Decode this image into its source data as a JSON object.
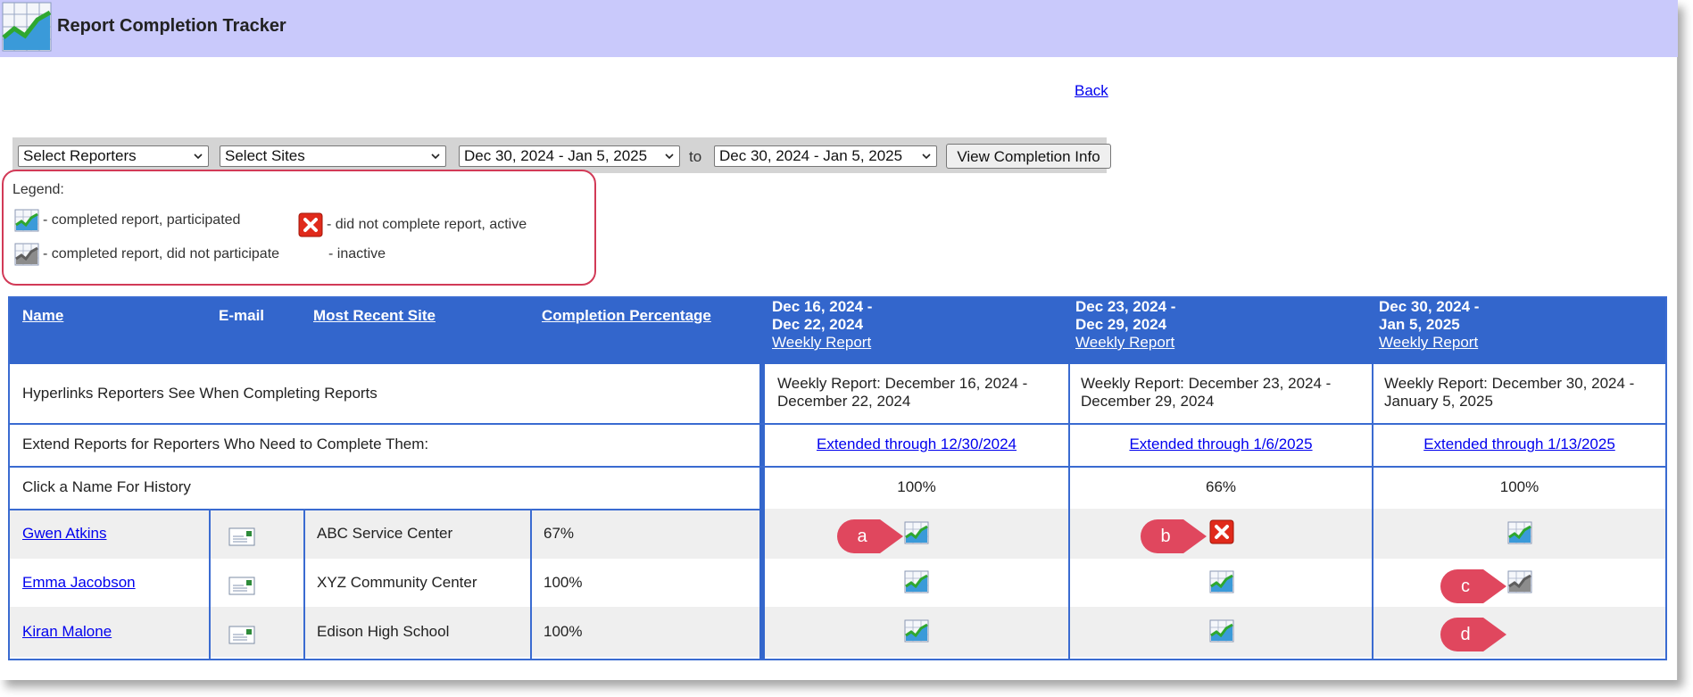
{
  "app": {
    "title": "Report Completion Tracker",
    "back_label": "Back"
  },
  "filters": {
    "reporters": "Select Reporters",
    "sites": "Select Sites",
    "date_from": "Dec 30, 2024 - Jan 5, 2025",
    "to_label": "to",
    "date_to": "Dec 30, 2024 - Jan 5, 2025",
    "view_button": "View Completion Info"
  },
  "legend": {
    "title": "Legend:",
    "completed_participated": "- completed report, participated",
    "completed_not_participated": "- completed report, did not participate",
    "not_complete_active": "- did not complete report, active",
    "inactive": "- inactive"
  },
  "table": {
    "headers": {
      "name": "Name",
      "email": "E-mail",
      "site": "Most Recent Site",
      "completion": "Completion Percentage"
    },
    "weeks": [
      {
        "line1": "Dec 16, 2024 -",
        "line2": "Dec 22, 2024",
        "weekly_link": "Weekly Report",
        "hyperlink_line1": "Weekly Report: December 16, 2024 -",
        "hyperlink_line2": "December 22, 2024",
        "extend_link": "Extended through 12/30/2024",
        "percent": "100%"
      },
      {
        "line1": "Dec 23, 2024 -",
        "line2": "Dec 29, 2024",
        "weekly_link": "Weekly Report",
        "hyperlink_line1": "Weekly Report: December 23, 2024 -",
        "hyperlink_line2": "December 29, 2024",
        "extend_link": "Extended through 1/6/2025",
        "percent": "66%"
      },
      {
        "line1": "Dec 30, 2024 -",
        "line2": "Jan 5, 2025",
        "weekly_link": "Weekly Report",
        "hyperlink_line1": "Weekly Report: December 30, 2024 -",
        "hyperlink_line2": "January 5, 2025",
        "extend_link": "Extended through 1/13/2025",
        "percent": "100%"
      }
    ],
    "hyperlinks_row_label": "Hyperlinks Reporters See When Completing Reports",
    "extend_row_label": "Extend Reports for Reporters Who Need to Complete Them:",
    "history_row_label": "Click a Name For History",
    "reporters": [
      {
        "name": "Gwen Atkins",
        "site": "ABC Service Center",
        "completion": "67%",
        "status": [
          "participated",
          "not-complete",
          "participated"
        ]
      },
      {
        "name": "Emma Jacobson",
        "site": "XYZ Community Center",
        "completion": "100%",
        "status": [
          "participated",
          "participated",
          "not-participated"
        ]
      },
      {
        "name": "Kiran Malone",
        "site": "Edison High School",
        "completion": "100%",
        "status": [
          "participated",
          "participated",
          "inactive"
        ]
      }
    ]
  },
  "callouts": [
    "a",
    "b",
    "c",
    "d"
  ],
  "colors": {
    "titlebar": "#c9c9fb",
    "table_header": "#3366cc",
    "callout": "#e0475e",
    "legend_border": "#d23a57",
    "link": "#0000ee"
  }
}
